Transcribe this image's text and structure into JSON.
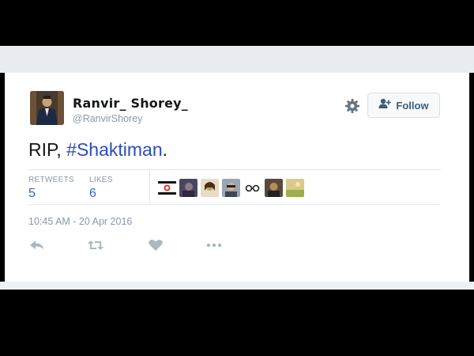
{
  "tweet": {
    "display_name": "Ranvir_ Shorey_",
    "handle": "@RanvirShorey",
    "text_prefix": "RIP, ",
    "hashtag": "#Shaktiman",
    "text_suffix": ".",
    "follow_label": "Follow",
    "stats": {
      "retweets_label": "RETWEETS",
      "retweets_value": "5",
      "likes_label": "LIKES",
      "likes_value": "6"
    },
    "timestamp": "10:45 AM - 20 Apr 2016",
    "liker_avatars": [
      "liker-avatar-1",
      "liker-avatar-2",
      "liker-avatar-3",
      "liker-avatar-4",
      "liker-avatar-5",
      "liker-avatar-6",
      "liker-avatar-7"
    ],
    "icons": [
      "settings-gear-icon",
      "follow-user-icon",
      "reply-icon",
      "retweet-icon",
      "like-heart-icon",
      "more-icon"
    ]
  },
  "colors": {
    "hashtag": "#2b4fb3",
    "stat_value": "#3b63b8",
    "muted": "#8899a6",
    "action_icon": "#aab8c2"
  }
}
